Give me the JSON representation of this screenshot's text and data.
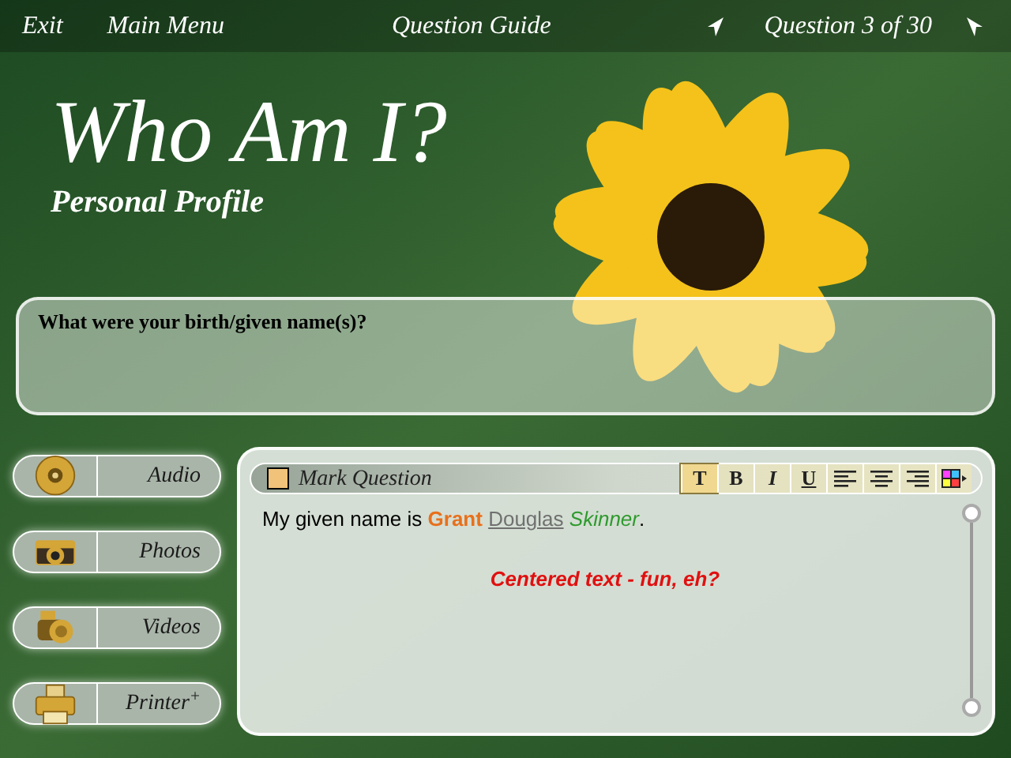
{
  "nav": {
    "items": [
      {
        "label": "Exit"
      },
      {
        "label": "Main Menu"
      }
    ],
    "guide": "Question Guide",
    "counter": "Question 3 of 30"
  },
  "title": "Who Am I?",
  "subtitle": "Personal Profile",
  "question": "What were your birth/given name(s)?",
  "media_buttons": [
    {
      "kind": "audio",
      "label": "Audio"
    },
    {
      "kind": "photos",
      "label": "Photos"
    },
    {
      "kind": "videos",
      "label": "Videos"
    },
    {
      "kind": "printer",
      "label": "Printer$^{+}$"
    }
  ],
  "editor": {
    "mark": {
      "label": "Mark Question",
      "checked": false
    },
    "toolbar": [
      {
        "kind": "text",
        "label": "T",
        "selected": true
      },
      {
        "kind": "text",
        "label": "B",
        "selected": false
      },
      {
        "kind": "text",
        "label": "I",
        "selected": false
      },
      {
        "kind": "text",
        "label": "U",
        "selected": false
      },
      {
        "kind": "align-left",
        "selected": false
      },
      {
        "kind": "align-center",
        "selected": false
      },
      {
        "kind": "align-right",
        "selected": false
      },
      {
        "kind": "color",
        "selected": false
      }
    ],
    "paragraphs": [
      {
        "kind": "left",
        "segments": [
          {
            "kind": "plain",
            "text": "My given name is"
          },
          {
            "kind": "bold",
            "text": "Grant",
            "color": "#e8701c"
          },
          {
            "kind": "underline",
            "text": "Douglas",
            "color": "#707070"
          },
          {
            "kind": "italic",
            "text": "Skinner",
            "color": "#2e9a2e"
          },
          {
            "kind": "punctuation",
            "text": "."
          }
        ]
      },
      {
        "kind": "center",
        "segments": [
          {
            "kind": "bold-italic",
            "text": "Centered text - fun, eh?",
            "color": "#e01010"
          }
        ]
      }
    ]
  }
}
